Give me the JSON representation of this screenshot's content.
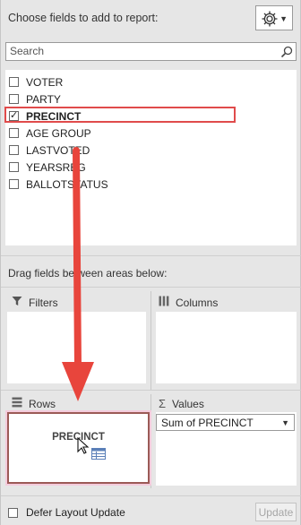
{
  "header": {
    "title": "Choose fields to add to report:",
    "tools_icon": "gear-icon"
  },
  "search": {
    "placeholder": "Search",
    "icon": "search-icon"
  },
  "fields": [
    {
      "label": "VOTER",
      "checked": false
    },
    {
      "label": "PARTY",
      "checked": false
    },
    {
      "label": "PRECINCT",
      "checked": true
    },
    {
      "label": "AGE GROUP",
      "checked": false
    },
    {
      "label": "LASTVOTED",
      "checked": false
    },
    {
      "label": "YEARSREG",
      "checked": false
    },
    {
      "label": "BALLOTSTATUS",
      "checked": false
    }
  ],
  "areas": {
    "instruction": "Drag fields between areas below:",
    "filters": {
      "label": "Filters",
      "icon": "filter-icon"
    },
    "columns": {
      "label": "Columns",
      "icon": "columns-icon"
    },
    "rows": {
      "label": "Rows",
      "icon": "rows-icon",
      "item": "PRECINCT"
    },
    "values": {
      "label": "Values",
      "icon": "sigma-icon",
      "item": "Sum of PRECINCT"
    }
  },
  "footer": {
    "defer_label": "Defer Layout Update",
    "defer_checked": false,
    "update_label": "Update"
  },
  "annotation": {
    "highlight_color": "#e04b4b",
    "arrow_color": "#e8453c",
    "drop_border_color": "#9b5a56"
  }
}
